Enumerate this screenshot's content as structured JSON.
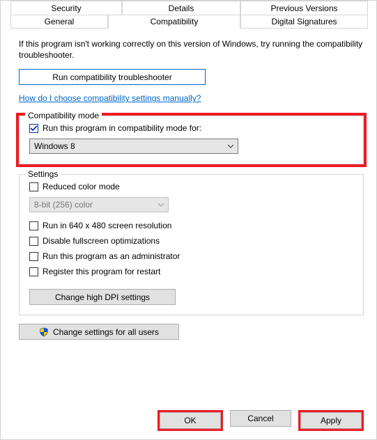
{
  "tabs": {
    "row1": [
      "Security",
      "Details",
      "Previous Versions"
    ],
    "row2": [
      "General",
      "Compatibility",
      "Digital Signatures"
    ],
    "active": "Compatibility"
  },
  "intro": "If this program isn't working correctly on this version of Windows, try running the compatibility troubleshooter.",
  "troubleshoot_btn": "Run compatibility troubleshooter",
  "help_link": "How do I choose compatibility settings manually?",
  "compat_group": {
    "title": "Compatibility mode",
    "check_label": "Run this program in compatibility mode for:",
    "check_value": true,
    "select_value": "Windows 8"
  },
  "settings_group": {
    "title": "Settings",
    "reduced_color": "Reduced color mode",
    "color_select": "8-bit (256) color",
    "run640": "Run in 640 x 480 screen resolution",
    "disable_fs": "Disable fullscreen optimizations",
    "run_admin": "Run this program as an administrator",
    "register_restart": "Register this program for restart",
    "dpi_btn": "Change high DPI settings"
  },
  "allusers_btn": "Change settings for all users",
  "footer": {
    "ok": "OK",
    "cancel": "Cancel",
    "apply": "Apply"
  }
}
